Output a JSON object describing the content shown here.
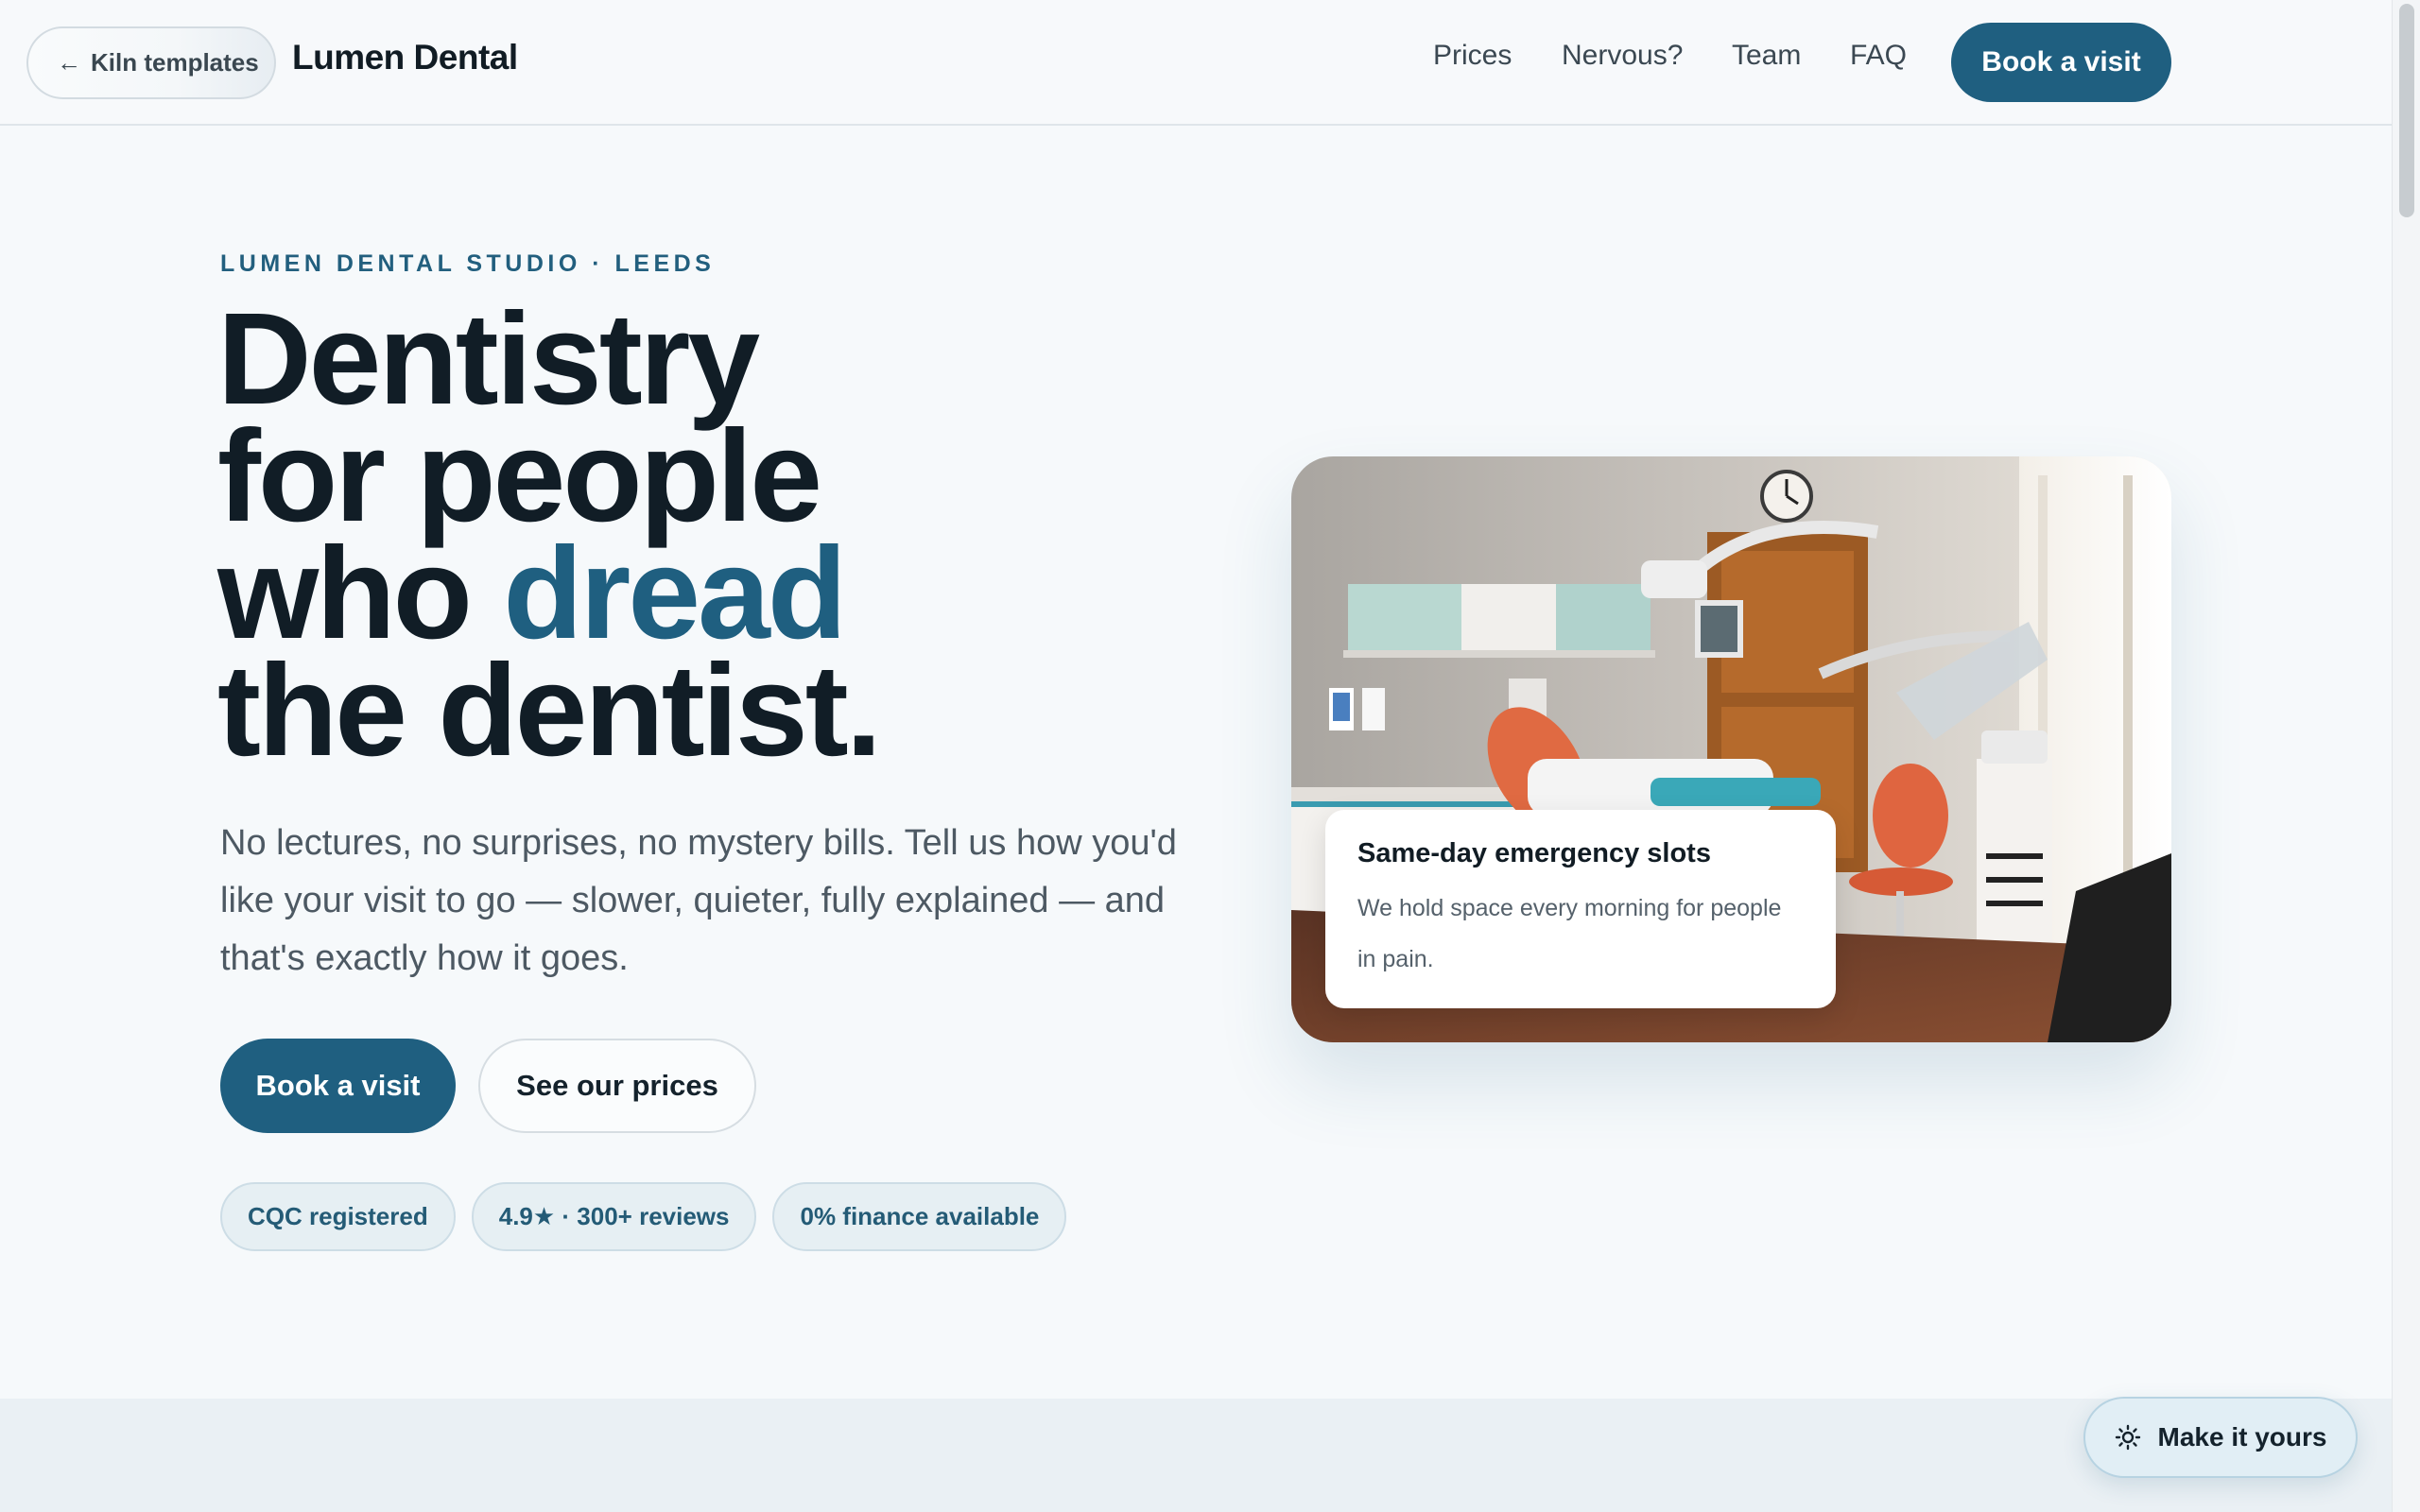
{
  "header": {
    "back_label": "Kiln templates",
    "back_arrow": "←",
    "brand": "Lumen Dental",
    "nav": [
      "Prices",
      "Nervous?",
      "Team",
      "FAQ"
    ],
    "cta": "Book a visit"
  },
  "hero": {
    "eyebrow": "LUMEN DENTAL STUDIO · LEEDS",
    "headline": {
      "line1": "Dentistry",
      "line2": "for people",
      "line3_start": "who ",
      "line3_accent": "dread",
      "line4": "the dentist."
    },
    "lede": "No lectures, no surprises, no mystery bills. Tell us how you'd like your visit to go — slower, quieter, fully explained — and that's exactly how it goes.",
    "primary_cta": "Book a visit",
    "secondary_cta": "See our prices",
    "badges": [
      "CQC registered",
      "4.9★ · 300+ reviews",
      "0% finance available"
    ]
  },
  "photo": {
    "icon": "dental-surgery-photo",
    "card_title": "Same-day emergency slots",
    "card_body": "We hold space every morning for people in pain."
  },
  "floating": {
    "label": "Make it yours",
    "icon": "sun-icon"
  },
  "colors": {
    "accent": "#1f5f80",
    "background": "#f6f9fb",
    "text": "#111d26",
    "badge_bg": "#e6eff3"
  }
}
